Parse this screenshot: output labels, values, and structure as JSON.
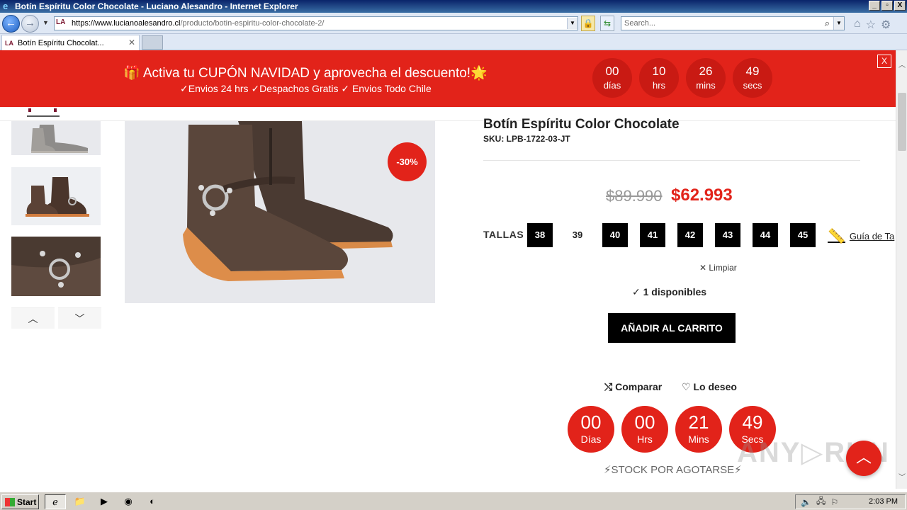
{
  "window": {
    "title": "Botín Espíritu Color Chocolate - Luciano Alesandro - Internet Explorer",
    "controls": [
      "_",
      "▫",
      "X"
    ]
  },
  "address_bar": {
    "url_host": "https://www.lucianoalesandro.cl",
    "url_path": "/producto/botin-espiritu-color-chocolate-2/",
    "search_placeholder": "Search..."
  },
  "tab": {
    "label": "Botín Espíritu Chocolat...",
    "favicon_text": "LA"
  },
  "promo": {
    "line1": "🎁 Activa tu CUPÓN NAVIDAD y aprovecha el descuento!🌟",
    "line2": "✓Envios 24 hrs ✓Despachos Gratis ✓ Envios Todo Chile",
    "countdown": [
      {
        "value": "00",
        "label": "días"
      },
      {
        "value": "10",
        "label": "hrs"
      },
      {
        "value": "26",
        "label": "mins"
      },
      {
        "value": "49",
        "label": "secs"
      }
    ],
    "close_label": "X",
    "bg_color": "#e2231a"
  },
  "product": {
    "title": "Botín Espíritu Color Chocolate",
    "sku": "SKU: LPB-1722-03-JT",
    "discount_badge": "-30%",
    "price_old": "$89.990",
    "price_new": "$62.993",
    "sizes_label": "TALLAS :",
    "sizes": [
      {
        "label": "38",
        "available": true
      },
      {
        "label": "39",
        "available": false
      },
      {
        "label": "40",
        "available": true
      },
      {
        "label": "41",
        "available": true
      },
      {
        "label": "42",
        "available": true
      },
      {
        "label": "43",
        "available": true
      },
      {
        "label": "44",
        "available": true
      },
      {
        "label": "45",
        "available": true
      }
    ],
    "size_guide": "Guía de Ta",
    "clear_label": "Limpiar",
    "availability": "1 disponibles",
    "add_to_cart": "AÑADIR AL CARRITO",
    "compare_label": "Comparar",
    "wishlist_label": "Lo deseo",
    "countdown": [
      {
        "value": "00",
        "label": "Días"
      },
      {
        "value": "00",
        "label": "Hrs"
      },
      {
        "value": "21",
        "label": "Mins"
      },
      {
        "value": "49",
        "label": "Secs"
      }
    ],
    "stock_label": "⚡STOCK POR AGOTARSE⚡"
  },
  "watermark": "ANY▷RUN",
  "taskbar": {
    "start_label": "Start",
    "clock": "2:03 PM"
  }
}
